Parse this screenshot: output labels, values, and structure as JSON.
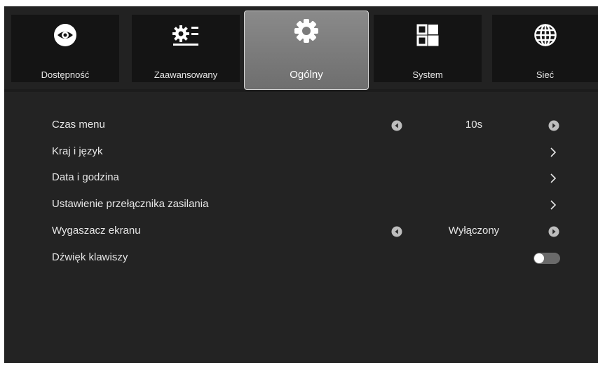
{
  "tabs": [
    {
      "label": "Dostępność",
      "icon": "eye-icon"
    },
    {
      "label": "Zaawansowany",
      "icon": "settings-list-icon"
    },
    {
      "label": "Ogólny",
      "icon": "gear-icon",
      "active": true
    },
    {
      "label": "System",
      "icon": "grid-icon"
    },
    {
      "label": "Sieć",
      "icon": "globe-icon"
    }
  ],
  "settings": [
    {
      "label": "Czas menu",
      "value": "10s",
      "control": "selector"
    },
    {
      "label": "Kraj i język",
      "control": "submenu"
    },
    {
      "label": "Data i godzina",
      "control": "submenu"
    },
    {
      "label": "Ustawienie przełącznika zasilania",
      "control": "submenu"
    },
    {
      "label": "Wygaszacz ekranu",
      "value": "Wyłączony",
      "control": "selector"
    },
    {
      "label": "Dźwięk klawiszy",
      "control": "toggle",
      "on": false
    }
  ],
  "colors": {
    "background": "#1c1c1c",
    "active_tab": "#7c7c7c",
    "text": "#e6e6e6"
  }
}
